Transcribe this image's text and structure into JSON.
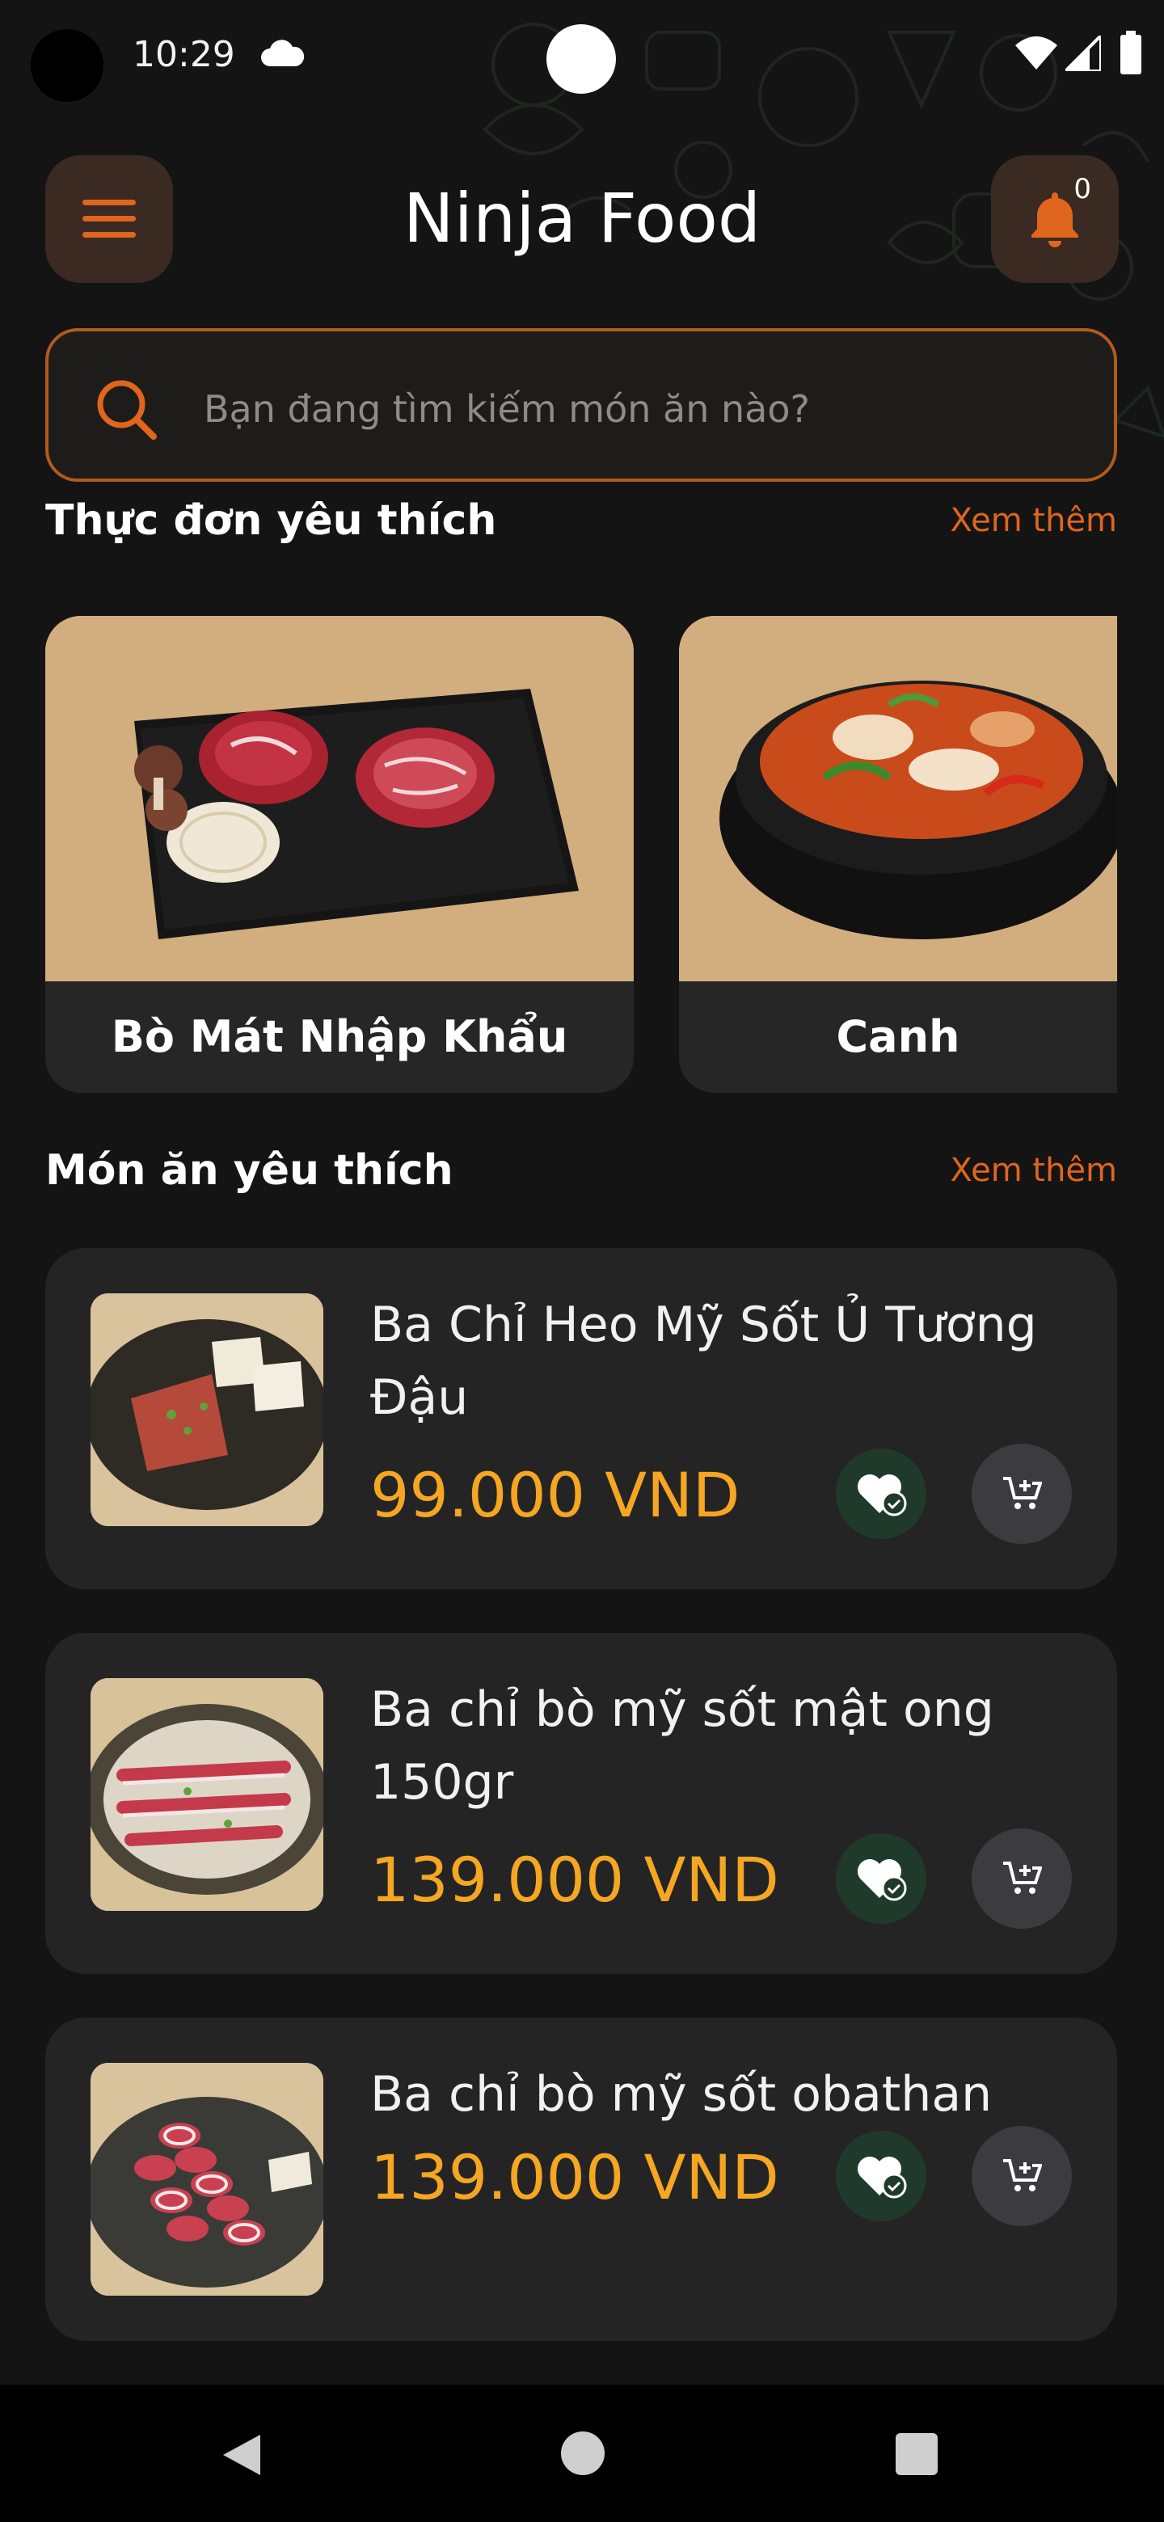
{
  "status_bar": {
    "time": "10:29"
  },
  "header": {
    "title": "Ninja Food",
    "notification_count": "0"
  },
  "search": {
    "placeholder": "Bạn đang tìm kiếm món ăn nào?"
  },
  "menu_section": {
    "title": "Thực đơn yêu thích",
    "see_more": "Xem thêm",
    "categories": [
      {
        "label": "Bò Mát Nhập Khẩu"
      },
      {
        "label": "Canh"
      }
    ]
  },
  "dish_section": {
    "title": "Món ăn yêu thích",
    "see_more": "Xem thêm",
    "dishes": [
      {
        "name": "Ba Chỉ Heo Mỹ Sốt Ủ Tương Đậu",
        "price": "99.000 VND"
      },
      {
        "name": "Ba chỉ bò mỹ sốt mật ong 150gr",
        "price": "139.000 VND"
      },
      {
        "name": "Ba chỉ bò mỹ sốt obathan",
        "price": "139.000 VND"
      }
    ]
  },
  "colors": {
    "accent_orange": "#e0651d",
    "price_yellow": "#f5a623",
    "background": "#141414",
    "card": "#242424"
  }
}
